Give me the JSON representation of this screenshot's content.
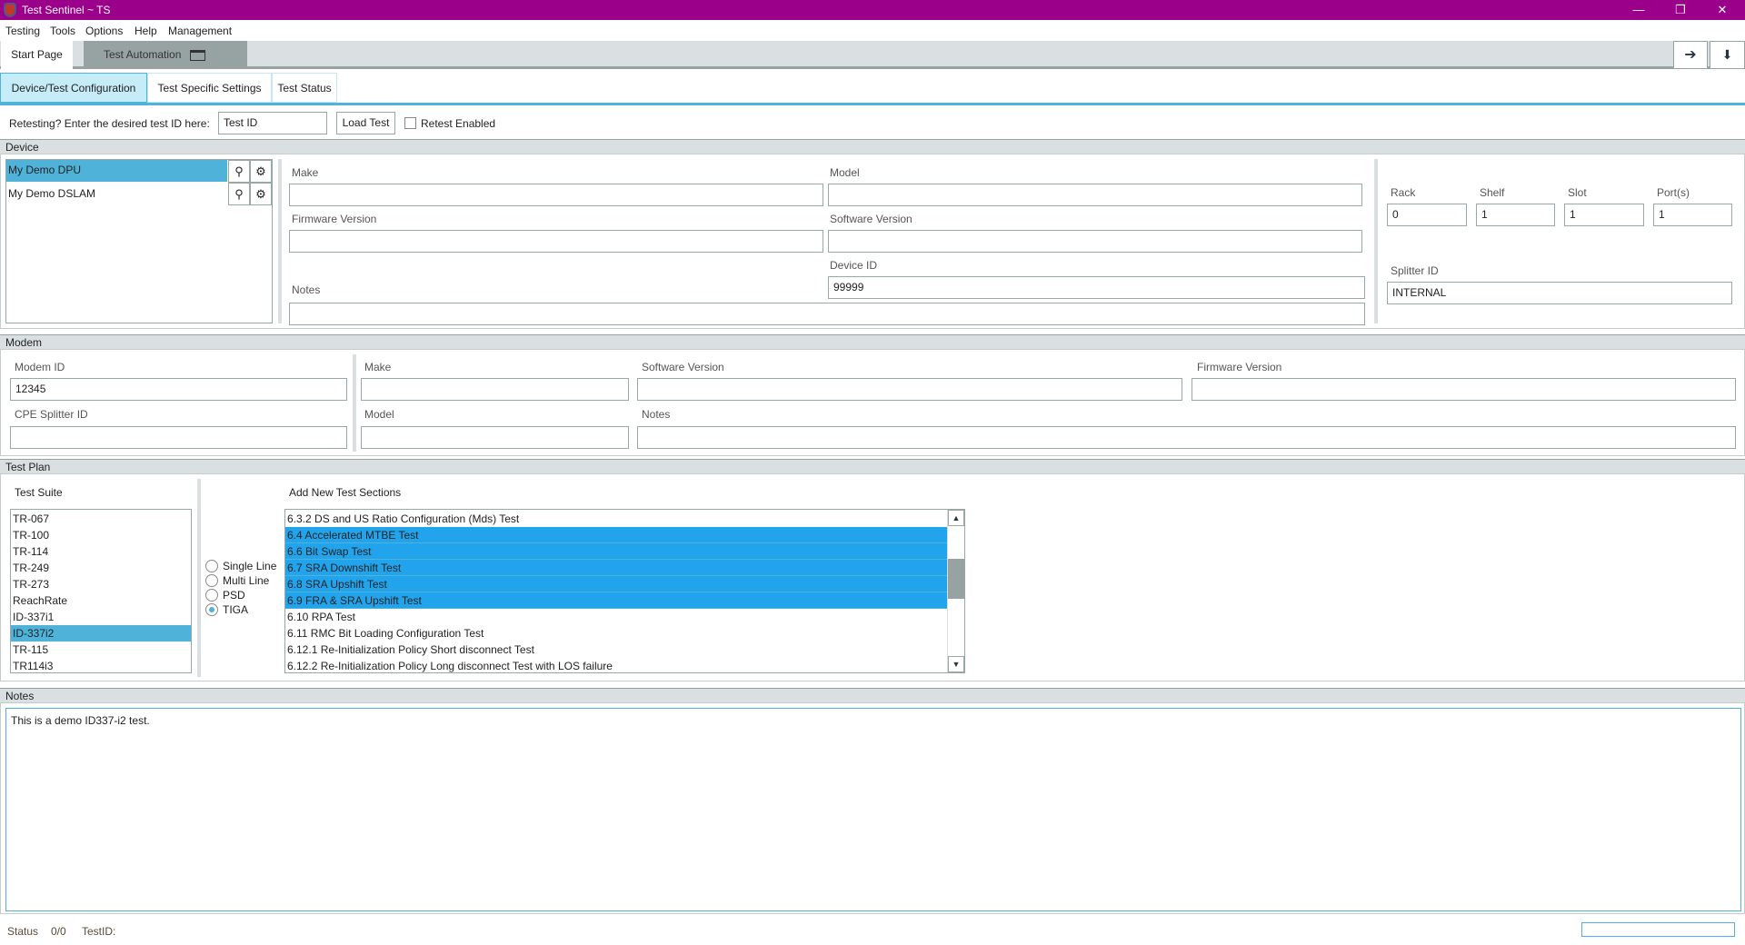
{
  "window": {
    "title": "Test Sentinel ~ TS",
    "accent": "#9b008a",
    "icon": "shield-logo-icon"
  },
  "menu": [
    "Testing",
    "Tools",
    "Options",
    "Help",
    "Management"
  ],
  "doc_tabs": {
    "start": "Start Page",
    "automation": "Test Automation",
    "close": "X"
  },
  "toolbar_icons": [
    "arrow-right-icon",
    "arrow-down-icon"
  ],
  "sub_tabs": [
    "Device/Test Configuration",
    "Test Specific Settings",
    "Test Status"
  ],
  "retest": {
    "label": "Retesting? Enter the desired test ID here:",
    "input_value": "Test ID",
    "load_button": "Load Test",
    "checkbox_label": "Retest Enabled",
    "checked": false
  },
  "device": {
    "header": "Device",
    "devices": [
      {
        "name": "My Demo DPU",
        "selected": true
      },
      {
        "name": "My Demo DSLAM",
        "selected": false
      }
    ],
    "make_label": "Make",
    "make": "",
    "model_label": "Model",
    "model": "",
    "firmware_label": "Firmware Version",
    "firmware": "",
    "software_label": "Software Version",
    "software": "",
    "device_id_label": "Device ID",
    "device_id": "99999",
    "notes_label": "Notes",
    "notes": "",
    "rack_label": "Rack",
    "rack": "0",
    "shelf_label": "Shelf",
    "shelf": "1",
    "slot_label": "Slot",
    "slot": "1",
    "ports_label": "Port(s)",
    "ports": "1",
    "splitter_label": "Splitter ID",
    "splitter": "INTERNAL"
  },
  "modem": {
    "header": "Modem",
    "modem_id_label": "Modem ID",
    "modem_id": "12345",
    "cpe_label": "CPE Splitter ID",
    "cpe": "",
    "make_label": "Make",
    "make": "",
    "model_label": "Model",
    "model": "",
    "software_label": "Software Version",
    "software": "",
    "firmware_label": "Firmware Version",
    "firmware": "",
    "notes_label": "Notes",
    "notes": ""
  },
  "test_plan": {
    "header": "Test Plan",
    "suite_label": "Test Suite",
    "suites": [
      "TR-067",
      "TR-100",
      "TR-114",
      "TR-249",
      "TR-273",
      "ReachRate",
      "ID-337i1",
      "ID-337i2",
      "TR-115",
      "TR114i3"
    ],
    "selected_suite": "ID-337i2",
    "modes": [
      "Single Line",
      "Multi Line",
      "PSD",
      "TIGA"
    ],
    "selected_mode": "TIGA",
    "sections_label": "Add New Test Sections",
    "sections": [
      {
        "name": "6.3.2 DS and US Ratio Configuration (Mds) Test",
        "selected": false
      },
      {
        "name": "6.4 Accelerated MTBE Test",
        "selected": true
      },
      {
        "name": "6.6 Bit Swap Test",
        "selected": true
      },
      {
        "name": "6.7 SRA Downshift Test",
        "selected": true
      },
      {
        "name": "6.8 SRA Upshift Test",
        "selected": true
      },
      {
        "name": "6.9 FRA & SRA Upshift Test",
        "selected": true
      },
      {
        "name": "6.10 RPA Test",
        "selected": false
      },
      {
        "name": "6.11 RMC Bit Loading Configuration Test",
        "selected": false
      },
      {
        "name": "6.12.1 Re-Initialization Policy Short disconnect Test",
        "selected": false
      },
      {
        "name": "6.12.2 Re-Initialization Policy Long disconnect Test with LOS failure",
        "selected": false
      }
    ]
  },
  "notes": {
    "header": "Notes",
    "text": "This is a demo ID337-i2 test."
  },
  "status": {
    "label": "Status",
    "count": "0/0",
    "test_id_label": "TestID:",
    "progress": 0
  }
}
